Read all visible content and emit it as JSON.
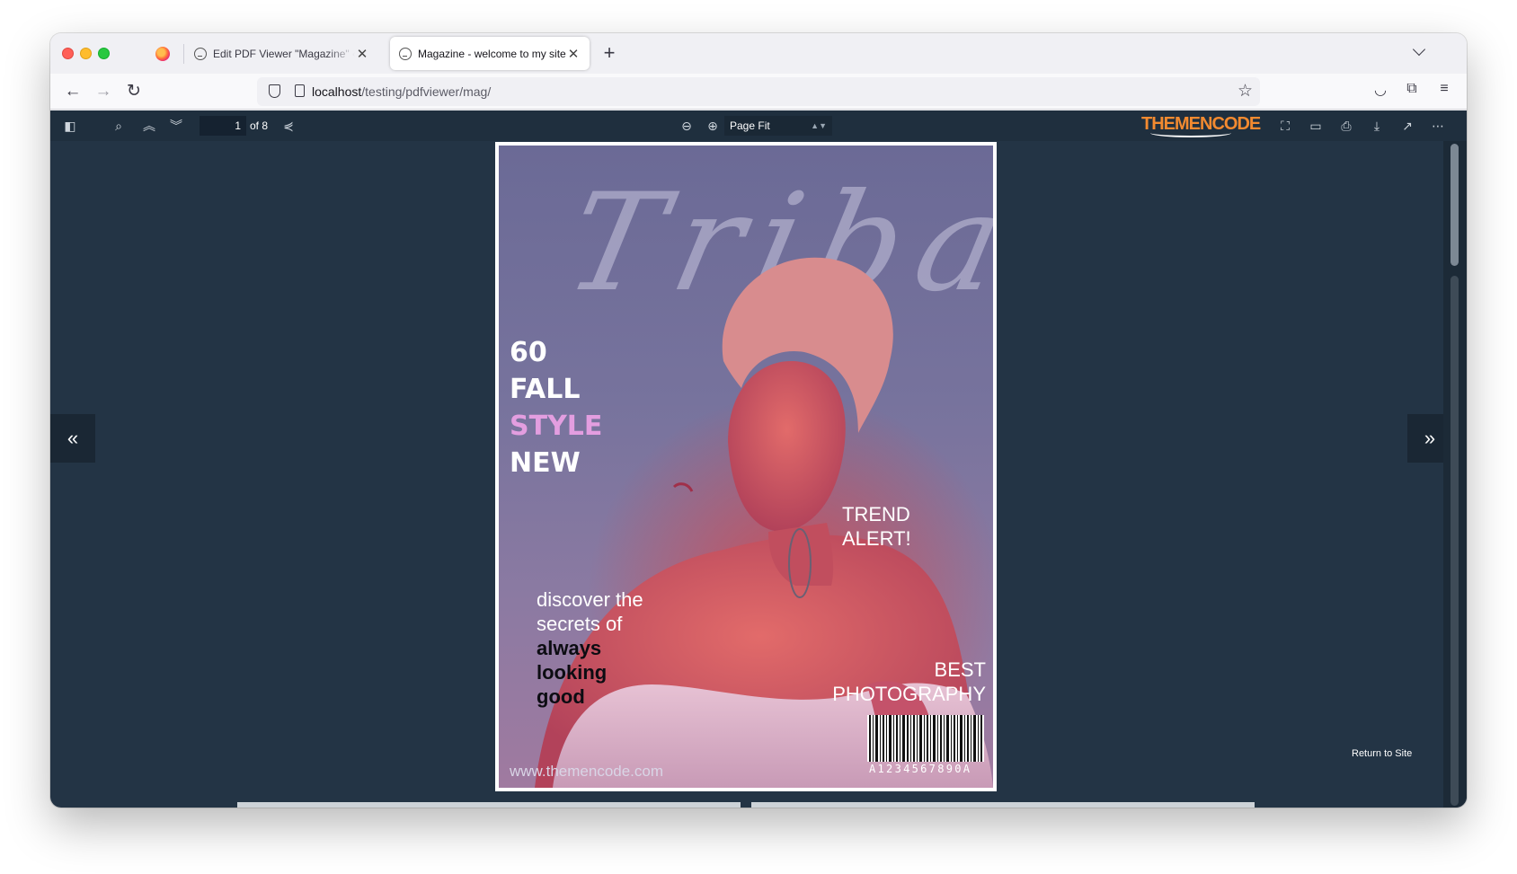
{
  "browser": {
    "tabs": [
      {
        "title": "Edit PDF Viewer \"Magazine\" ‹ wi"
      },
      {
        "title": "Magazine - welcome to my site"
      }
    ],
    "url_host": "localhost",
    "url_path": "/testing/pdfviewer/mag/"
  },
  "viewer": {
    "current_page": "1",
    "page_count_label": "of 8",
    "zoom_value": "Page Fit",
    "brand_logo": "THEMENCODE",
    "return_link": "Return to Site",
    "accent_color": "#f28a30",
    "background_color": "#233445"
  },
  "cover": {
    "script_title": "Tribal",
    "headline": [
      "60",
      "FALL",
      "STYLE",
      "NEW"
    ],
    "trend": [
      "TREND",
      "ALERT!"
    ],
    "discover_plain": [
      "discover the",
      "secrets of"
    ],
    "discover_bold": [
      "always",
      "looking",
      "good"
    ],
    "best_photo": [
      "BEST",
      "PHOTOGRAPHY"
    ],
    "barcode_number": "A1234567890A",
    "site_url": "www.themencode.com"
  }
}
